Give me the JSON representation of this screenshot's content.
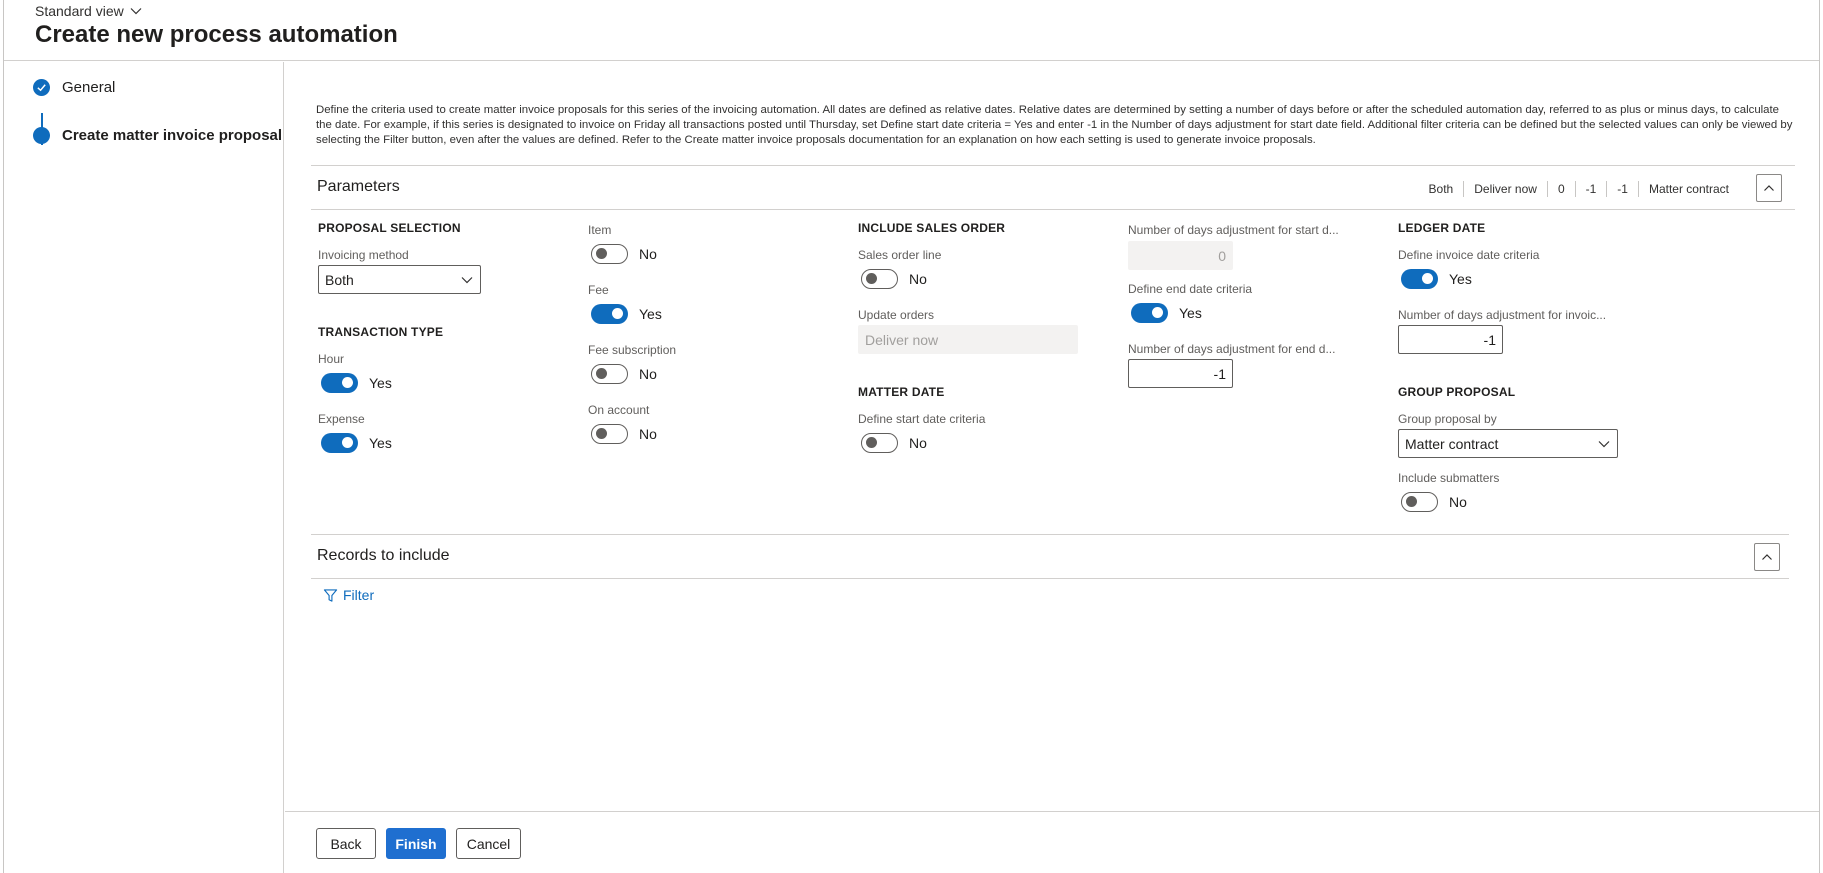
{
  "header": {
    "view": "Standard view",
    "title": "Create new process automation"
  },
  "steps": [
    {
      "label": "General",
      "state": "completed"
    },
    {
      "label": "Create matter invoice proposal",
      "state": "current"
    }
  ],
  "description": "Define the criteria used to create matter invoice proposals for this series of the invoicing automation. All dates are defined as relative dates. Relative dates are determined by setting a number of days before or after the scheduled automation day, referred to as plus or minus days, to calculate the date. For example, if this series is designated to invoice on Friday all transactions posted until Thursday, set Define start date criteria = Yes and enter -1 in the Number of days adjustment for start date field. Additional filter criteria can be defined but the selected values can only be viewed by selecting the Filter button, even after the values are defined. Refer to the Create matter invoice proposals documentation for an explanation on how each setting is used to generate invoice proposals.",
  "parameters": {
    "title": "Parameters",
    "summary": [
      "Both",
      "Deliver now",
      "0",
      "-1",
      "-1",
      "Matter contract"
    ],
    "proposal_selection": {
      "heading": "PROPOSAL SELECTION",
      "invoicing_method_label": "Invoicing method",
      "invoicing_method_value": "Both"
    },
    "transaction_type": {
      "heading": "TRANSACTION TYPE",
      "hour_label": "Hour",
      "hour_value": "Yes",
      "expense_label": "Expense",
      "expense_value": "Yes",
      "item_label": "Item",
      "item_value": "No",
      "fee_label": "Fee",
      "fee_value": "Yes",
      "fee_subscription_label": "Fee subscription",
      "fee_subscription_value": "No",
      "on_account_label": "On account",
      "on_account_value": "No"
    },
    "include_sales_order": {
      "heading": "INCLUDE SALES ORDER",
      "sales_order_line_label": "Sales order line",
      "sales_order_line_value": "No",
      "update_orders_label": "Update orders",
      "update_orders_value": "Deliver now"
    },
    "matter_date": {
      "heading": "MATTER DATE",
      "define_start_label": "Define start date criteria",
      "define_start_value": "No",
      "start_days_label": "Number of days adjustment for start d...",
      "start_days_value": "0",
      "define_end_label": "Define end date criteria",
      "define_end_value": "Yes",
      "end_days_label": "Number of days adjustment for end d...",
      "end_days_value": "-1"
    },
    "ledger_date": {
      "heading": "LEDGER DATE",
      "define_invoice_label": "Define invoice date criteria",
      "define_invoice_value": "Yes",
      "invoice_days_label": "Number of days adjustment for invoic...",
      "invoice_days_value": "-1"
    },
    "group_proposal": {
      "heading": "GROUP PROPOSAL",
      "group_by_label": "Group proposal by",
      "group_by_value": "Matter contract",
      "include_sub_label": "Include submatters",
      "include_sub_value": "No"
    }
  },
  "records": {
    "title": "Records to include",
    "filter_label": "Filter"
  },
  "footer": {
    "back": "Back",
    "finish": "Finish",
    "cancel": "Cancel"
  },
  "colors": {
    "accent": "#0f6cbd",
    "primary_button": "#1f6fd0"
  }
}
